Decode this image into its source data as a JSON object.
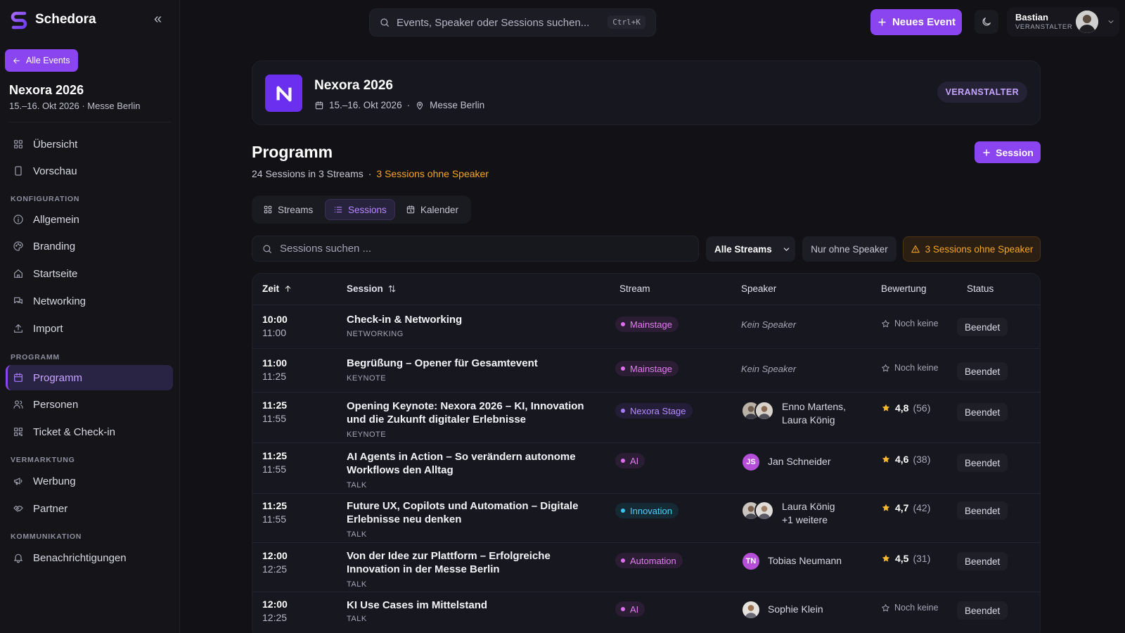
{
  "app": {
    "name": "Schedora",
    "collapse_glyph": "«"
  },
  "sidebar": {
    "back_label": "Alle Events",
    "event_name": "Nexora 2026",
    "event_meta": "15.–16. Okt 2026 · Messe Berlin",
    "items": [
      {
        "label": "Übersicht",
        "icon": "grid-icon"
      },
      {
        "label": "Vorschau",
        "icon": "phone-icon"
      },
      {
        "label": "Allgemein",
        "icon": "info-icon"
      },
      {
        "label": "Branding",
        "icon": "palette-icon"
      },
      {
        "label": "Startseite",
        "icon": "home-icon"
      },
      {
        "label": "Networking",
        "icon": "chat-icon"
      },
      {
        "label": "Import",
        "icon": "upload-icon"
      },
      {
        "label": "Programm",
        "icon": "calendar-icon",
        "active": true
      },
      {
        "label": "Personen",
        "icon": "users-icon"
      },
      {
        "label": "Ticket & Check-in",
        "icon": "qr-icon"
      },
      {
        "label": "Werbung",
        "icon": "megaphone-icon"
      },
      {
        "label": "Partner",
        "icon": "handshake-icon"
      },
      {
        "label": "Benachrichtigungen",
        "icon": "bell-icon"
      }
    ],
    "sections": [
      "KONFIGURATION",
      "PROGRAMM",
      "VERMARKTUNG",
      "KOMMUNIKATION"
    ]
  },
  "topbar": {
    "search_placeholder": "Events, Speaker oder Sessions suchen...",
    "shortcut": "Ctrl+K",
    "new_event_label": "Neues Event",
    "user": {
      "name": "Bastian",
      "role": "VERANSTALTER"
    }
  },
  "event": {
    "logo_letter": "N",
    "title": "Nexora 2026",
    "date": "15.–16. Okt 2026",
    "separator": "·",
    "location": "Messe Berlin",
    "role_badge": "VERANSTALTER"
  },
  "program": {
    "title": "Programm",
    "summary": "24 Sessions in 3 Streams",
    "dot": "·",
    "warning": "3 Sessions ohne Speaker",
    "add_session_label": "Session",
    "tabs": [
      "Streams",
      "Sessions",
      "Kalender"
    ],
    "active_tab": "Sessions"
  },
  "filters": {
    "search_placeholder": "Sessions suchen ...",
    "streams_label": "Alle Streams",
    "no_speaker_label": "Nur ohne Speaker",
    "warning_label": "3 Sessions ohne Speaker"
  },
  "table": {
    "headers": {
      "time": "Zeit",
      "session": "Session",
      "stream": "Stream",
      "speaker": "Speaker",
      "rating": "Bewertung",
      "status": "Status"
    },
    "rows": [
      {
        "start": "10:00",
        "end": "11:00",
        "title": "Check-in & Networking",
        "type": "NETWORKING",
        "stream": "Mainstage",
        "speaker": "Kein Speaker",
        "rating": "Noch keine",
        "status": "Beendet"
      },
      {
        "start": "11:00",
        "end": "11:25",
        "title": "Begrüßung – Opener für Gesamtevent",
        "type": "KEYNOTE",
        "stream": "Mainstage",
        "speaker": "Kein Speaker",
        "rating": "Noch keine",
        "status": "Beendet"
      },
      {
        "start": "11:25",
        "end": "11:55",
        "title": "Opening Keynote: Nexora 2026 – KI, Innovation und die Zukunft digitaler Erlebnisse",
        "type": "KEYNOTE",
        "stream": "Nexora Stage",
        "speaker_line1": "Enno Martens,",
        "speaker_line2": "Laura König",
        "score": "4,8",
        "count": "(56)",
        "status": "Beendet"
      },
      {
        "start": "11:25",
        "end": "11:55",
        "title": "AI Agents in Action – So verändern autonome Workflows den Alltag",
        "type": "TALK",
        "stream": "AI",
        "initials": "JS",
        "speaker": "Jan Schneider",
        "score": "4,6",
        "count": "(38)",
        "status": "Beendet"
      },
      {
        "start": "11:25",
        "end": "11:55",
        "title": "Future UX, Copilots und Automation – Digitale Erlebnisse neu denken",
        "type": "TALK",
        "stream": "Innovation",
        "speaker_line1": "Laura König",
        "speaker_line2": "+1 weitere",
        "score": "4,7",
        "count": "(42)",
        "status": "Beendet"
      },
      {
        "start": "12:00",
        "end": "12:25",
        "title": "Von der Idee zur Plattform – Erfolgreiche Innovation in der Messe Berlin",
        "type": "TALK",
        "stream": "Automation",
        "initials": "TN",
        "speaker": "Tobias Neumann",
        "score": "4,5",
        "count": "(31)",
        "status": "Beendet"
      },
      {
        "start": "12:00",
        "end": "12:25",
        "title": "KI Use Cases im Mittelstand",
        "type": "TALK",
        "stream": "AI",
        "speaker": "Sophie Klein",
        "rating": "Noch keine",
        "status": "Beendet"
      }
    ]
  },
  "colors": {
    "accent": "#8b45f0",
    "warning": "#f5a623",
    "stream_mainstage": "#e06cf0",
    "stream_nexora": "#a77bff",
    "stream_ai": "#e06cf0",
    "stream_innovation": "#38c6f0",
    "stream_automation": "#e06cf0",
    "star": "#f5b82e"
  }
}
